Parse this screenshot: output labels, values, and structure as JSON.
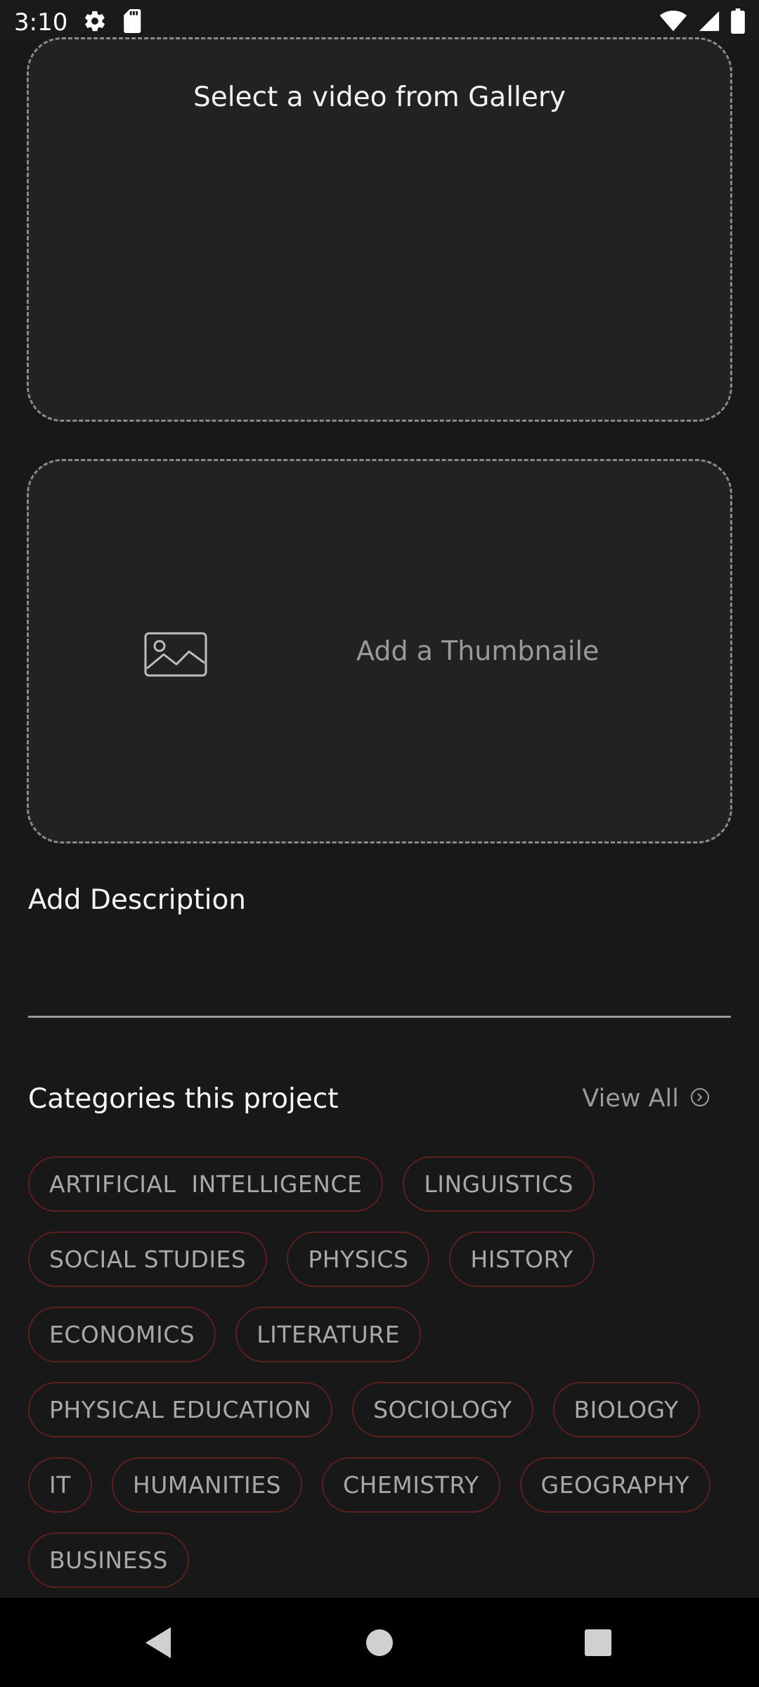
{
  "status_bar": {
    "time": "3:10",
    "left_icons": [
      "gear-icon",
      "sd-card-icon"
    ],
    "right_icons": [
      "wifi-icon",
      "signal-icon",
      "battery-icon"
    ]
  },
  "video_picker": {
    "label": "Select a video from Gallery"
  },
  "thumbnail_picker": {
    "icon": "image-icon",
    "label": "Add a Thumbnaile"
  },
  "description": {
    "label": "Add Description",
    "value": ""
  },
  "categories": {
    "title": "Categories this project",
    "view_all_label": "View All",
    "view_all_icon": "chevron-circle-icon",
    "items": [
      "ARTIFICIAL  INTELLIGENCE",
      "LINGUISTICS",
      "SOCIAL STUDIES",
      "PHYSICS",
      "HISTORY",
      "ECONOMICS",
      "LITERATURE",
      "PHYSICAL EDUCATION",
      "SOCIOLOGY",
      "BIOLOGY",
      "IT",
      "HUMANITIES",
      "CHEMISTRY",
      "GEOGRAPHY",
      "BUSINESS"
    ]
  },
  "nav_bar": {
    "buttons": [
      "back-icon",
      "home-icon",
      "recents-icon"
    ]
  },
  "colors": {
    "background": "#181818",
    "card": "#222222",
    "chip_border": "#5c1f1f",
    "muted_text": "#9a9a9a"
  }
}
